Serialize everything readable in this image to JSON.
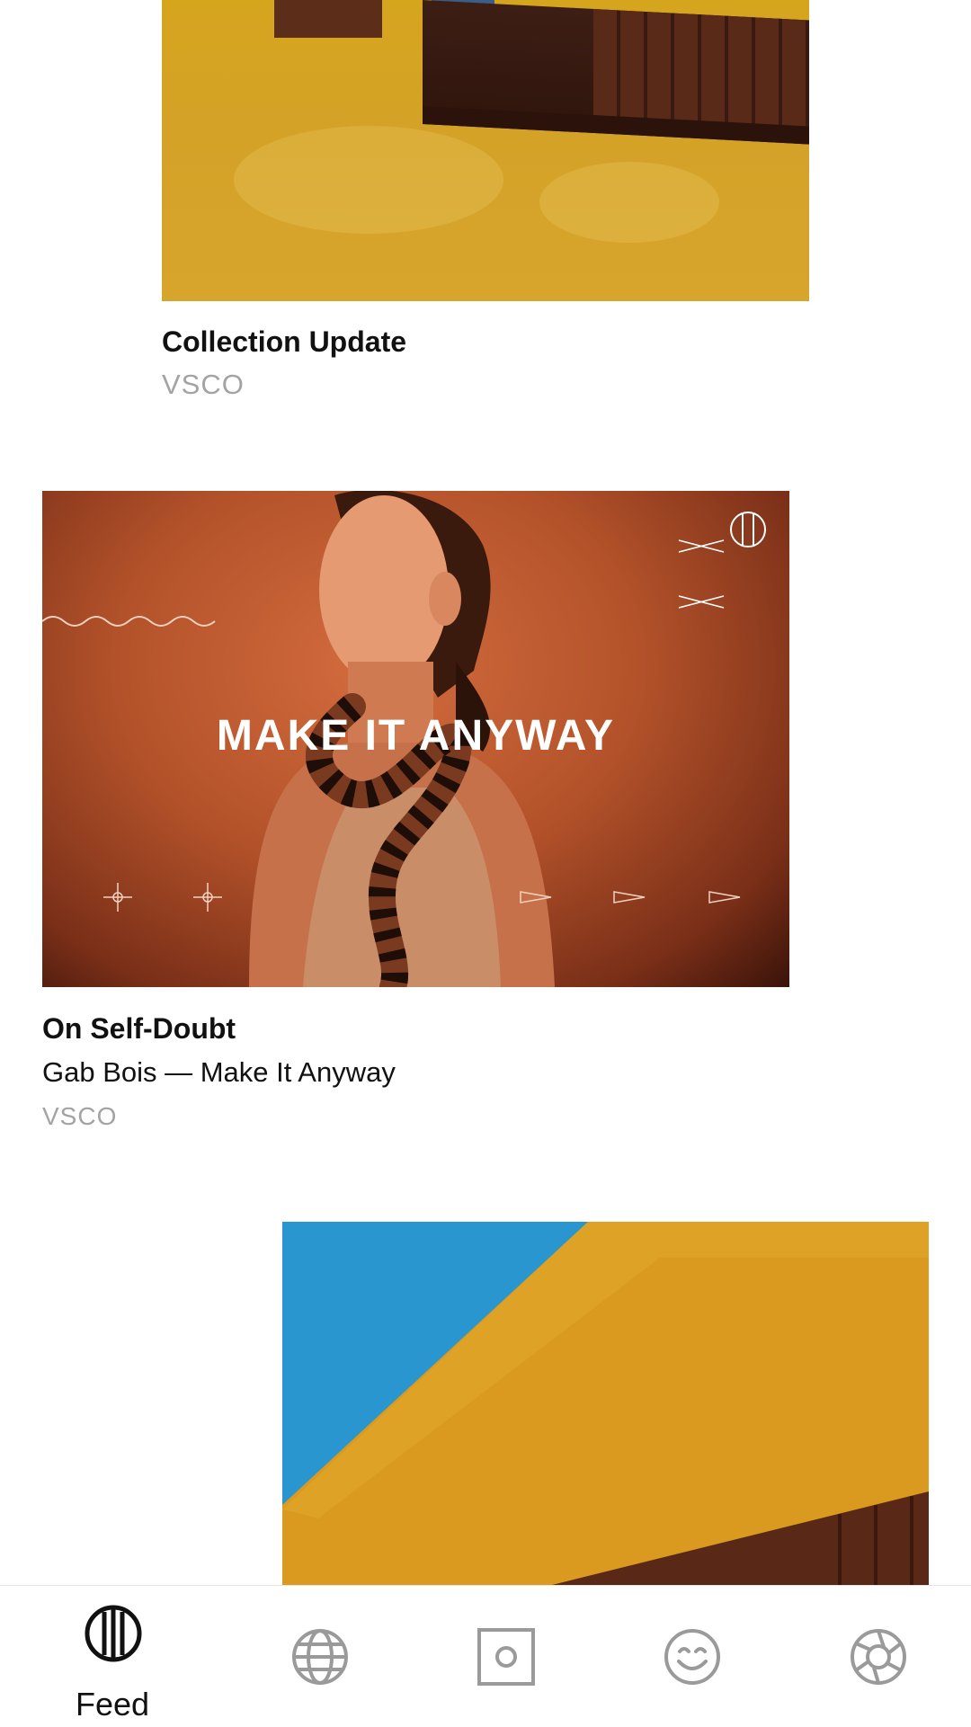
{
  "feed": {
    "cards": [
      {
        "title": "Collection Update",
        "source": "VSCO"
      },
      {
        "title": "On Self-Doubt",
        "subtitle": "Gab Bois — Make It Anyway",
        "source": "VSCO",
        "image_text": "MAKE IT ANYWAY"
      }
    ]
  },
  "bottom_nav": {
    "items": [
      {
        "name": "feed",
        "label": "Feed",
        "icon": "vsco-feed-icon",
        "active": true
      },
      {
        "name": "discover",
        "label": "",
        "icon": "globe-icon",
        "active": false
      },
      {
        "name": "studio",
        "label": "",
        "icon": "camera-square-icon",
        "active": false
      },
      {
        "name": "profile",
        "label": "",
        "icon": "smiley-icon",
        "active": false
      },
      {
        "name": "settings",
        "label": "",
        "icon": "aperture-icon",
        "active": false
      }
    ],
    "active_color": "#111111",
    "inactive_color": "#9a9a9a"
  }
}
